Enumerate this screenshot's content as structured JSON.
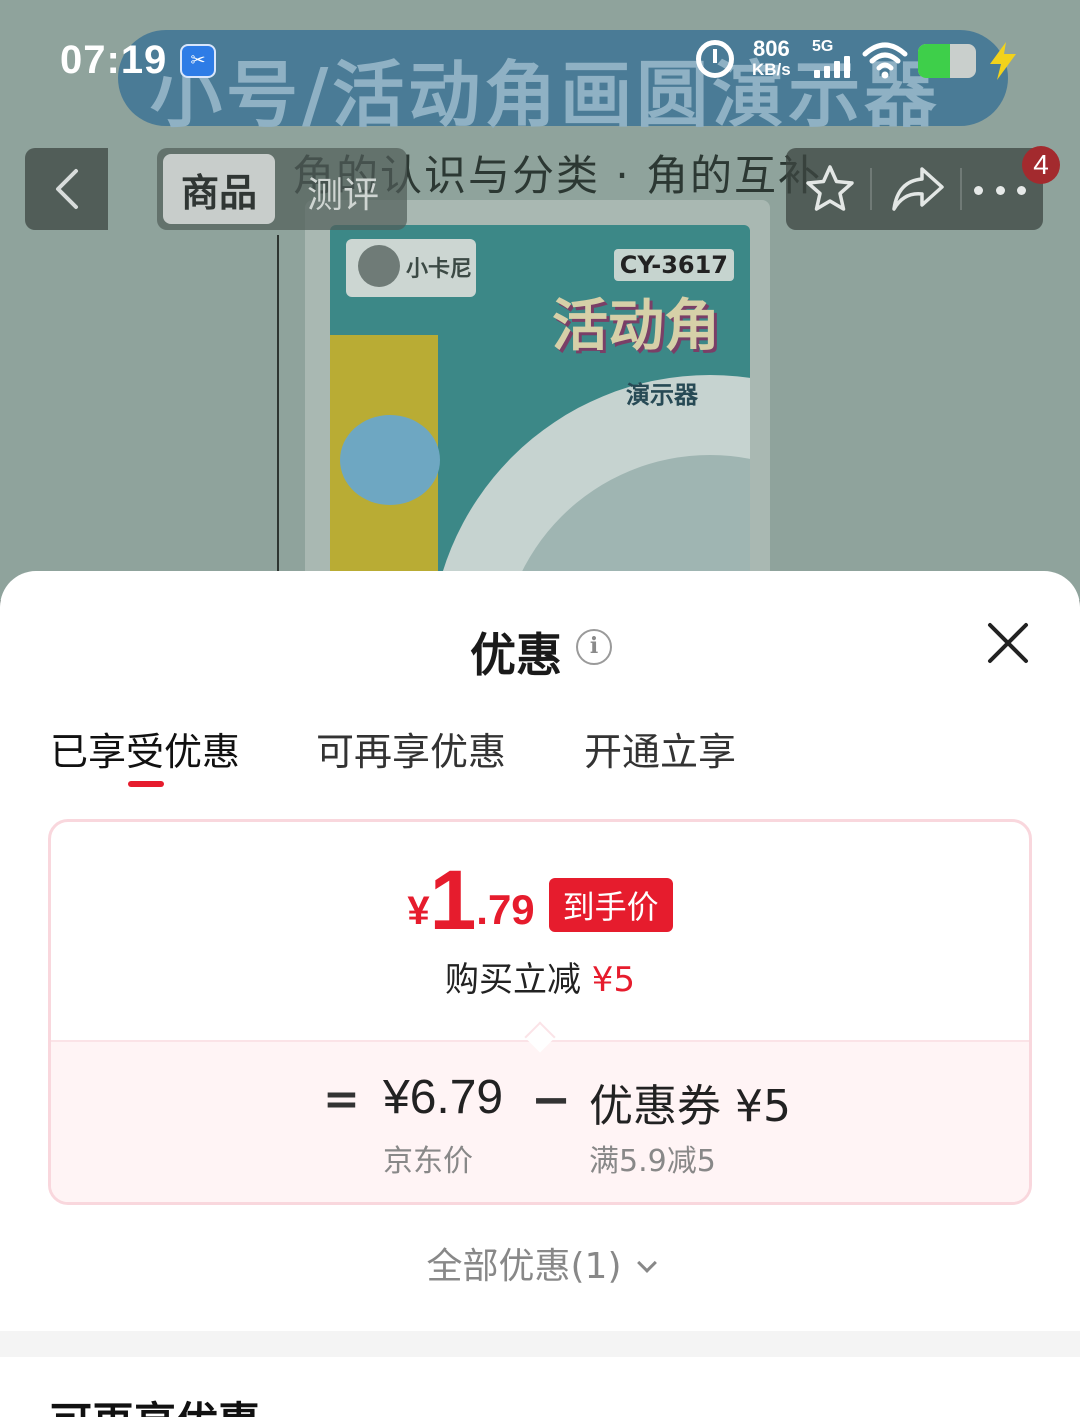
{
  "background": {
    "banner_text": "小号/活动角画圆演示器",
    "subtitle": "角的认识与分类 · 角的互补",
    "product": {
      "brand": "小卡尼",
      "model": "CY-3617",
      "name": "活动角",
      "sub": "演示器"
    }
  },
  "status_bar": {
    "time": "07:19",
    "net_speed_value": "806",
    "net_speed_unit": "KB/s",
    "network": "5G",
    "battery_level": 0.55
  },
  "nav": {
    "tabs": [
      {
        "label": "商品",
        "active": true
      },
      {
        "label": "测评",
        "active": false
      }
    ],
    "cart_badge": "4"
  },
  "sheet": {
    "title": "优惠",
    "tabs": [
      {
        "label": "已享受优惠",
        "active": true
      },
      {
        "label": "可再享优惠",
        "active": false
      },
      {
        "label": "开通立享",
        "active": false
      }
    ],
    "final_price": {
      "currency": "¥",
      "integer": "1",
      "decimal": ".79",
      "tag": "到手价"
    },
    "reduction": {
      "label": "购买立减",
      "amount": "¥5"
    },
    "formula": {
      "equals": "=",
      "jd_price": "¥6.79",
      "jd_price_label": "京东价",
      "minus": "−",
      "coupon": "优惠券 ¥5",
      "coupon_rule": "满5.9减5"
    },
    "all_offers": "全部优惠(1)",
    "next_section_title": "可再享优惠"
  },
  "colors": {
    "accent_red": "#e61c2d",
    "card_border": "#f9d7dd",
    "card_bottom_bg": "#fff4f5"
  }
}
